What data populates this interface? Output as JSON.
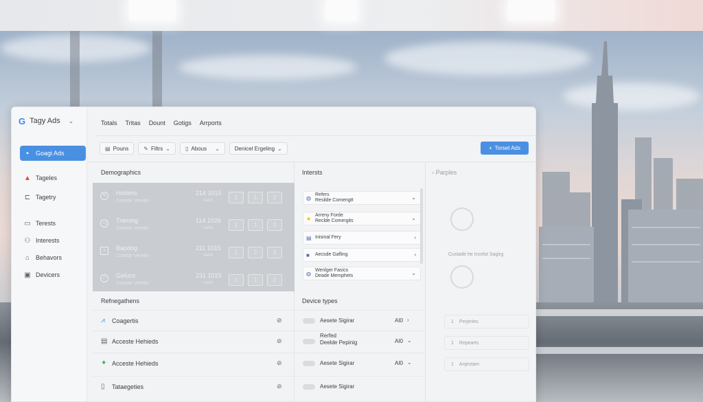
{
  "brand": {
    "logo": "G",
    "name": "Tagy Ads"
  },
  "sidebar": {
    "items": [
      {
        "label": "Goagi Ads",
        "icon": "ads-icon",
        "active": true
      },
      {
        "label": "Tageles",
        "icon": "tags-icon",
        "active": false
      },
      {
        "label": "Tagetry",
        "icon": "list-icon",
        "active": false
      },
      {
        "label": "Terests",
        "icon": "folder-icon",
        "active": false
      },
      {
        "label": "Interests",
        "icon": "people-icon",
        "active": false
      },
      {
        "label": "Behavors",
        "icon": "location-icon",
        "active": false
      },
      {
        "label": "Devicers",
        "icon": "device-icon",
        "active": false
      }
    ]
  },
  "tabs": [
    "Totals",
    "Tritas",
    "Dount",
    "Gotigs",
    "Arrports"
  ],
  "filters": [
    {
      "label": "Pouns",
      "icon": "doc-icon"
    },
    {
      "label": "Filtrs",
      "icon": "edit-icon"
    },
    {
      "label": "Abous",
      "icon": "list-icon"
    },
    {
      "label": "Denicel Ergeling",
      "icon": ""
    }
  ],
  "primary_button": {
    "label": "Torset Ads",
    "icon": "+"
  },
  "demographics": {
    "title": "Demographics",
    "rows": [
      {
        "name": "Hotlerts",
        "sub": "Coteide Veretts",
        "value": "214 1015",
        "unit": "Aatid",
        "boxes": [
          "1",
          "1",
          "2"
        ]
      },
      {
        "name": "Triening",
        "sub": "Coteide Veretts",
        "value": "114 1026",
        "unit": "Aatid",
        "boxes": [
          "1",
          "1",
          "3"
        ]
      },
      {
        "name": "Bapdog",
        "sub": "Cotaide Veretts",
        "value": "211 1015",
        "unit": "Aatid",
        "boxes": [
          "1",
          "2",
          "3"
        ]
      },
      {
        "name": "Geluce",
        "sub": "Cotaide Veretts",
        "value": "231 1015",
        "unit": "Aatid",
        "boxes": [
          "1",
          "1",
          "2"
        ]
      }
    ]
  },
  "interests": {
    "title": "Intersts",
    "rows": [
      {
        "l1": "Refers",
        "l2": "Resilde Comengtt",
        "chev": "⌄"
      },
      {
        "l1": "Arreny Forde",
        "l2": "Reclde Comergits",
        "chev": "⌄"
      },
      {
        "l1": "Inisinal Fery",
        "l2": "",
        "chev": "›"
      },
      {
        "l1": "Aecsde Gafling",
        "l2": "",
        "chev": "›"
      },
      {
        "l1": "Wenlger Fasics",
        "l2": "Deade Memphets",
        "chev": "⌄"
      }
    ]
  },
  "right_panel": {
    "title": "Parples",
    "caption": "Custade he Incelst Sagirg",
    "cards": [
      {
        "num": "1",
        "label": "Perjeries"
      },
      {
        "num": "1",
        "label": "Repearts"
      },
      {
        "num": "1",
        "label": "Anjestam"
      }
    ]
  },
  "refinements": {
    "title": "Refnegathens",
    "rows": [
      {
        "label": "Coagertis",
        "icon": "chart-icon"
      },
      {
        "label": "Acceste Hehieds",
        "icon": "doc-icon"
      },
      {
        "label": "Acceste Hehieds",
        "icon": "google-icon"
      },
      {
        "label": "Tataegeties",
        "icon": "page-icon"
      }
    ]
  },
  "device_types": {
    "title": "Device types",
    "rows": [
      {
        "l1": "Aesete Sigirar",
        "l2": "",
        "value": "AI0",
        "chev": "›"
      },
      {
        "l1": "Rerfed",
        "l2": "Deelde Pepinig",
        "value": "AI0",
        "chev": "⌄"
      },
      {
        "l1": "Aesete Sigirar",
        "l2": "",
        "value": "AI0",
        "chev": "⌄"
      },
      {
        "l1": "Aesete Sigirar",
        "l2": "",
        "value": "",
        "chev": ""
      }
    ]
  },
  "colors": {
    "accent": "#4a90e2",
    "panel": "#f1f3f5",
    "demo_block": "#c9ccd0"
  }
}
